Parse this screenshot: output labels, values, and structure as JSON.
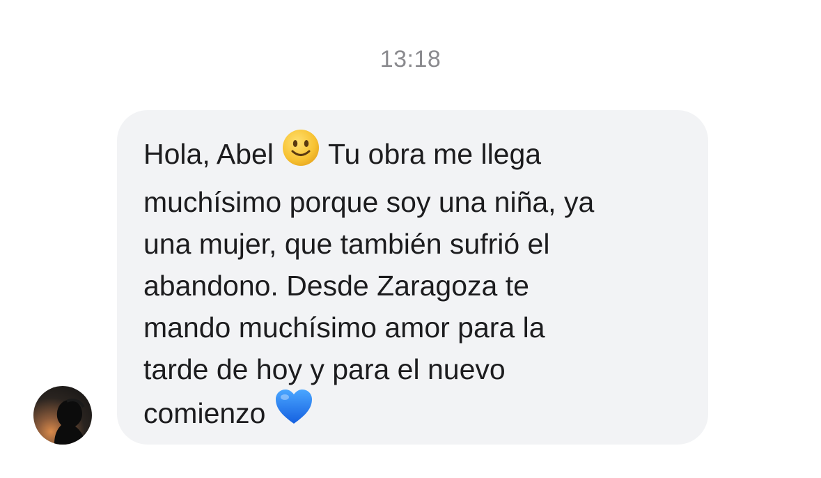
{
  "thread": {
    "timestamp": "13:18"
  },
  "message": {
    "sender_avatar": "silhouette-sunset-avatar",
    "greeting": "Hola, Abel ",
    "emoji_1": "slightly-smiling-face-emoji",
    "text_after_emoji": " Tu obra me llega\nmuchísimo porque soy una niña, ya\nuna mujer, que también sufrió el\nabandono. Desde Zaragoza te\nmando muchísimo amor para la\ntarde de hoy y para el nuevo\ncomienzo ",
    "emoji_2": "blue-heart-emoji"
  },
  "colors": {
    "bubble_background": "#f2f3f5",
    "text": "#1c1c1e",
    "timestamp": "#8a8a8e",
    "heart": "#1f7bf2",
    "smiley": "#f7c232"
  }
}
